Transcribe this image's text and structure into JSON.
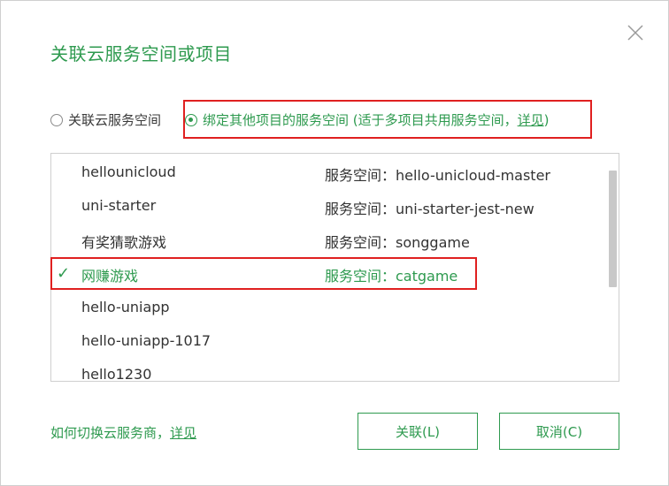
{
  "dialog": {
    "title": "关联云服务空间或项目",
    "close_icon": "close-icon"
  },
  "options": {
    "option1_label": "关联云服务空间",
    "option2_label": "绑定其他项目的服务空间 (适于多项目共用服务空间，",
    "option2_link": "详见",
    "option2_suffix": ")",
    "selected": "option2"
  },
  "projects": [
    {
      "name": "hellounicloud",
      "space": "服务空间：hello-unicloud-master",
      "selected": false
    },
    {
      "name": "uni-starter",
      "space": "服务空间：uni-starter-jest-new",
      "selected": false
    },
    {
      "name": "有奖猜歌游戏",
      "space": "服务空间：songgame",
      "selected": false
    },
    {
      "name": "网赚游戏",
      "space": "服务空间：catgame",
      "selected": true
    },
    {
      "name": "hello-uniapp",
      "space": "",
      "selected": false
    },
    {
      "name": "hello-uniapp-1017",
      "space": "",
      "selected": false
    },
    {
      "name": "hello1230",
      "space": "",
      "selected": false
    }
  ],
  "footer": {
    "help_text": "如何切换云服务商，",
    "help_link": "详见",
    "confirm_label": "关联(L)",
    "cancel_label": "取消(C)"
  },
  "colors": {
    "accent": "#2e9a4f",
    "highlight_box": "#e02020"
  }
}
